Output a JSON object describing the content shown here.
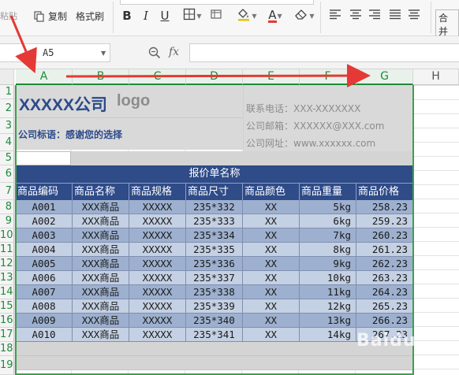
{
  "ribbon": {
    "paste_label": "粘贴",
    "copy_label": "复制",
    "format_painter_label": "格式刷",
    "bold_label": "B",
    "italic_label": "I",
    "underline_label": "U",
    "font_color_label": "A",
    "merge_label": "合并"
  },
  "formula_bar": {
    "name_box": "A5",
    "fx_label": "fx",
    "formula_value": ""
  },
  "columns": [
    "A",
    "B",
    "C",
    "D",
    "E",
    "F",
    "G",
    "H"
  ],
  "rows": [
    "1",
    "2",
    "3",
    "4",
    "5",
    "6",
    "7",
    "8",
    "9",
    "10",
    "11",
    "12",
    "13",
    "14",
    "15",
    "16",
    "17",
    "18",
    "19"
  ],
  "sheet": {
    "company_name": "XXXXX公司",
    "company_logo": "logo",
    "slogan": "公司标语：感谢您的选择",
    "phone": "联系电话：XXX-XXXXXXX",
    "email": "公司邮箱：XXXXXX@XXX.com",
    "website": "公司网址：www.xxxxxx.com",
    "table_title": "报价单名称",
    "headers": [
      "商品编码",
      "商品名称",
      "商品规格",
      "商品尺寸",
      "商品颜色",
      "商品重量",
      "商品价格"
    ],
    "items": [
      [
        "A001",
        "XXX商品",
        "XXXXX",
        "235*332",
        "XX",
        "5kg",
        "258.23"
      ],
      [
        "A002",
        "XXX商品",
        "XXXXX",
        "235*333",
        "XX",
        "6kg",
        "259.23"
      ],
      [
        "A003",
        "XXX商品",
        "XXXXX",
        "235*334",
        "XX",
        "7kg",
        "260.23"
      ],
      [
        "A004",
        "XXX商品",
        "XXXXX",
        "235*335",
        "XX",
        "8kg",
        "261.23"
      ],
      [
        "A005",
        "XXX商品",
        "XXXXX",
        "235*336",
        "XX",
        "9kg",
        "262.23"
      ],
      [
        "A006",
        "XXX商品",
        "XXXXX",
        "235*337",
        "XX",
        "10kg",
        "263.23"
      ],
      [
        "A007",
        "XXX商品",
        "XXXXX",
        "235*338",
        "XX",
        "11kg",
        "264.23"
      ],
      [
        "A008",
        "XXX商品",
        "XXXXX",
        "235*339",
        "XX",
        "12kg",
        "265.23"
      ],
      [
        "A009",
        "XXX商品",
        "XXXXX",
        "235*340",
        "XX",
        "13kg",
        "266.23"
      ],
      [
        "A010",
        "XXX商品",
        "XXXXX",
        "235*341",
        "XX",
        "14kg",
        "267.23"
      ]
    ]
  },
  "colors": {
    "header_blue": "#2f4b88",
    "row_dark": "#9db0cf",
    "row_light": "#c4d0e3",
    "selection_green": "#3ea04b",
    "annotation_red": "#e53935"
  },
  "watermark": "Baidu"
}
